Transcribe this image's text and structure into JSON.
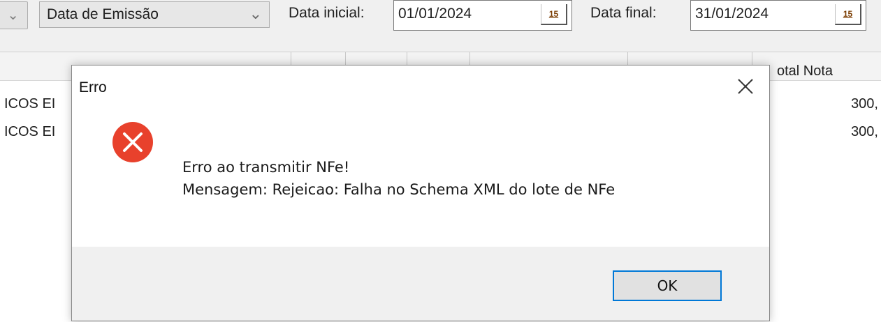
{
  "toolbar": {
    "filter_field": "Data de Emissão",
    "start_label": "Data inicial:",
    "start_value": "01/01/2024",
    "end_label": "Data final:",
    "end_value": "31/01/2024",
    "calendar_glyph": "15"
  },
  "grid": {
    "last_column_title": "otal Nota",
    "rows": [
      {
        "name_partial": "ICOS EI",
        "total_partial": "300,"
      },
      {
        "name_partial": "ICOS EI",
        "total_partial": "300,"
      }
    ]
  },
  "dialog": {
    "title": "Erro",
    "line1": "Erro ao transmitir NFe!",
    "line2": "Mensagem: Rejeicao: Falha no Schema XML do lote de NFe",
    "ok_label": "OK",
    "icon": "error-x-icon",
    "icon_color": "#e8412c",
    "focus_color": "#0078d7"
  }
}
